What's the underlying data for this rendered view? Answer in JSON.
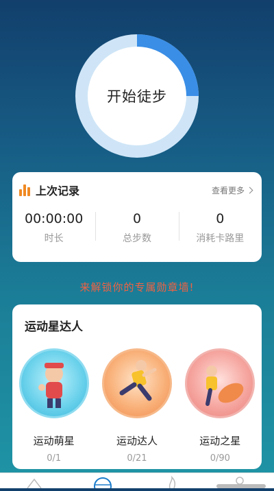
{
  "hero": {
    "start_label": "开始徒步",
    "ring_progress": 0.25,
    "colors": {
      "ring_fill": "#3a8ee6",
      "ring_track": "#cfe5f7"
    }
  },
  "last_record": {
    "icon": "bar-chart-icon",
    "title": "上次记录",
    "more_label": "查看更多",
    "stats": [
      {
        "value": "00:00:00",
        "label": "时长"
      },
      {
        "value": "0",
        "label": "总步数"
      },
      {
        "value": "0",
        "label": "消耗卡路里"
      }
    ]
  },
  "promo_text": "来解锁你的专属勋章墙!",
  "badges": {
    "title": "运动星达人",
    "items": [
      {
        "name": "运动萌星",
        "progress": "0/1",
        "icon": "cute-runner-badge-icon"
      },
      {
        "name": "运动达人",
        "progress": "0/21",
        "icon": "jumping-runner-badge-icon"
      },
      {
        "name": "运动之星",
        "progress": "0/90",
        "icon": "star-runner-badge-icon"
      }
    ]
  },
  "nav": {
    "items": [
      "home-icon",
      "globe-icon",
      "fire-icon",
      "profile-icon"
    ]
  },
  "colors": {
    "accent_orange": "#f08a24",
    "promo_red": "#f06243",
    "bg_top": "#123f6c",
    "bg_bottom": "#1f95a6"
  }
}
